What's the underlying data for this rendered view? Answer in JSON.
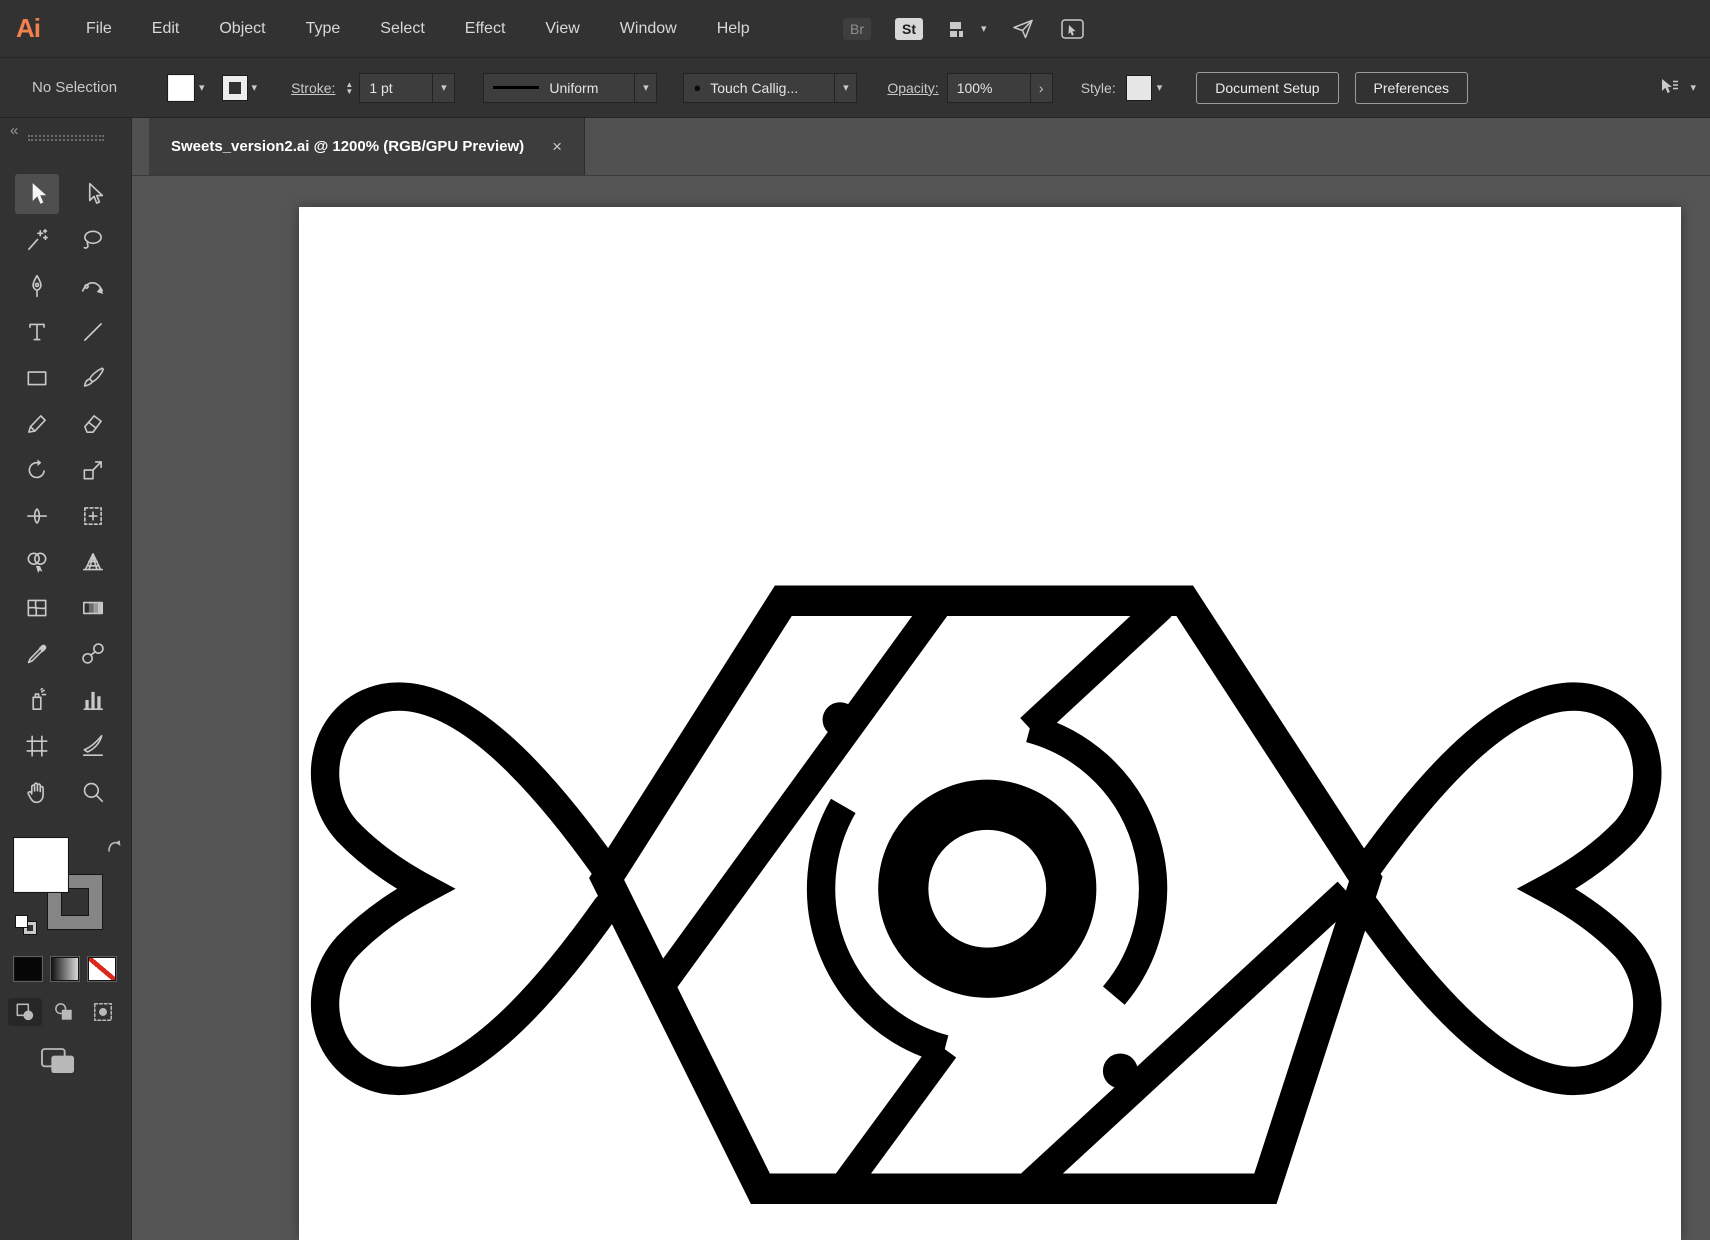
{
  "app": {
    "brand": "Ai",
    "brand_color": "#F2814E"
  },
  "menu_bar": {
    "items": [
      "File",
      "Edit",
      "Object",
      "Type",
      "Select",
      "Effect",
      "View",
      "Window",
      "Help"
    ],
    "bridge_badge": "Br",
    "stock_badge": "St"
  },
  "control_bar": {
    "selection_status": "No Selection",
    "stroke_label": "Stroke:",
    "stroke_weight_value": "1 pt",
    "width_profile_value": "Uniform",
    "brush_value": "Touch Callig...",
    "opacity_label": "Opacity:",
    "opacity_value": "100%",
    "style_label": "Style:",
    "document_setup_button": "Document Setup",
    "preferences_button": "Preferences"
  },
  "document_tab": {
    "title": "Sweets_version2.ai @ 1200% (RGB/GPU Preview)",
    "close_glyph": "×"
  },
  "toolbar": {
    "collapse_glyph": "«",
    "tools": [
      "selection",
      "direct-selection",
      "magic-wand",
      "lasso",
      "pen",
      "curvature",
      "type",
      "line-segment",
      "rectangle",
      "paintbrush",
      "pencil",
      "eraser",
      "rotate",
      "scale",
      "width",
      "free-transform",
      "shape-builder",
      "perspective-grid",
      "mesh",
      "gradient",
      "eyedropper",
      "blend",
      "symbol-sprayer",
      "column-graph",
      "artboard",
      "slice",
      "hand",
      "zoom"
    ],
    "active_tool": "selection"
  },
  "icons": {
    "chevron_down": "▾",
    "chevron_right": "›",
    "stepper_up": "▲",
    "stepper_down": "▼",
    "brush_dot": "●"
  },
  "colors": {
    "panel_bg": "#323232",
    "pasteboard_bg": "#555555",
    "artboard_bg": "#ffffff",
    "artwork_ink": "#000000"
  }
}
